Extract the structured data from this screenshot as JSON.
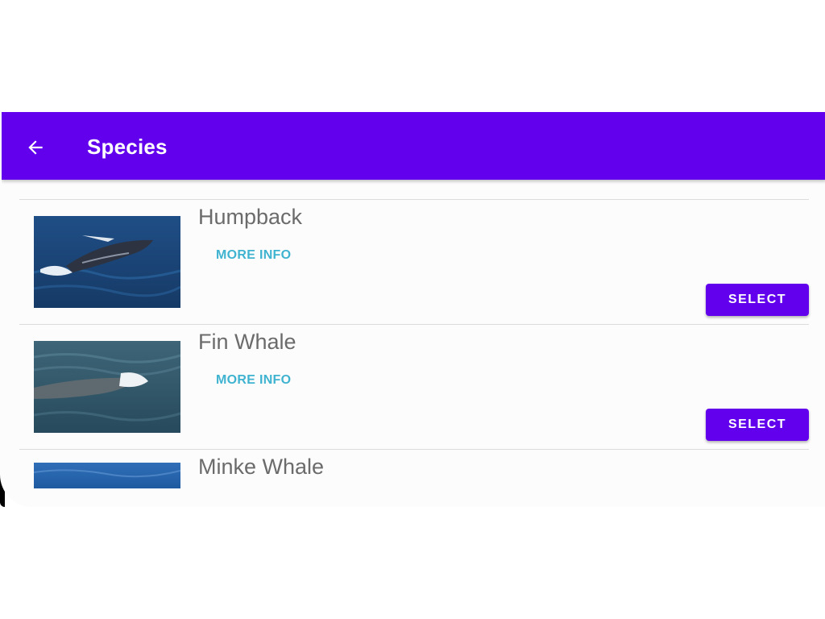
{
  "app_bar": {
    "title": "Species",
    "back_icon": "arrow-back-icon",
    "color": "#6200ee"
  },
  "species": [
    {
      "name": "Humpback",
      "more_info_label": "MORE INFO",
      "select_label": "SELECT",
      "image": "humpback-whale-photo"
    },
    {
      "name": "Fin Whale",
      "more_info_label": "MORE INFO",
      "select_label": "SELECT",
      "image": "fin-whale-photo"
    },
    {
      "name": "Minke Whale",
      "image": "minke-whale-photo"
    }
  ],
  "colors": {
    "accent": "#6200ee",
    "link": "#3fb3d0",
    "title_text": "#6b6b6b"
  }
}
